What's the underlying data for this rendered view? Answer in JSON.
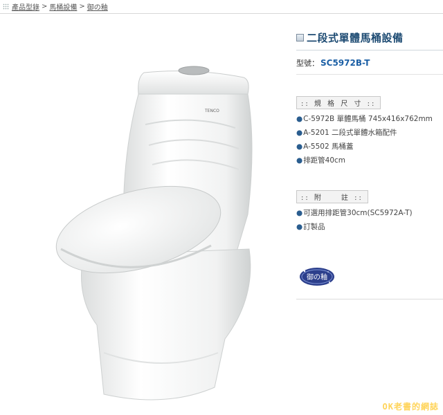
{
  "breadcrumb": {
    "items": [
      "產品型錄",
      "馬桶設備",
      "御の釉"
    ],
    "separator": ">"
  },
  "product": {
    "title": "二段式單體馬桶設備",
    "model_label": "型號：",
    "model_value": "SC5972B-T",
    "brand_on_tank": "TENCO"
  },
  "spec": {
    "heading": "規 格 尺 寸",
    "items": [
      "C-5972B 單體馬桶 745x416x762mm",
      "A-5201 二段式單體水箱配件",
      "A-5502 馬桶蓋",
      "排距管40cm"
    ]
  },
  "note": {
    "heading": "附　　註",
    "items": [
      "可選用排距管30cm(SC5972A-T)",
      "訂製品"
    ]
  },
  "badge": {
    "label": "御の釉"
  },
  "watermark": {
    "text": "OK老書的網誌"
  },
  "colors": {
    "title": "#1c4a72",
    "model": "#1b5fa5",
    "watermark": "#ffd45a",
    "badge": "#2c3f8c"
  }
}
